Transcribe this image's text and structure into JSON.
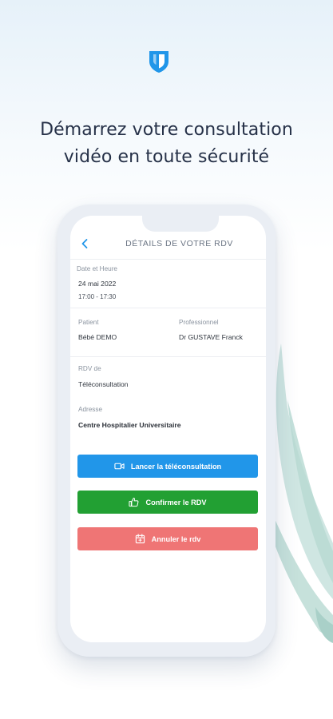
{
  "headline": {
    "line1": "Démarrez votre consultation",
    "line2": "vidéo en toute sécurité"
  },
  "screen": {
    "title": "DÉTAILS DE VOTRE RDV",
    "date_label": "Date et Heure",
    "date_value": "24 mai 2022",
    "time_value": "17:00 - 17:30",
    "patient_label": "Patient",
    "patient_value": "Bébé DEMO",
    "professional_label": "Professionnel",
    "professional_value": "Dr GUSTAVE Franck",
    "rdv_label": "RDV de",
    "rdv_value": "Téléconsultation",
    "address_label": "Adresse",
    "address_value": "Centre Hospitalier Universitaire",
    "buttons": {
      "teleconsult": "Lancer la téléconsultation",
      "confirm": "Confirmer le RDV",
      "cancel": "Annuler le rdv"
    }
  },
  "colors": {
    "brand_blue": "#2196e9",
    "confirm_green": "#22a033",
    "cancel_red": "#ef7575",
    "headline_text": "#263148"
  },
  "icons": [
    "shield-icon",
    "back-chevron-icon",
    "video-camera-icon",
    "thumbs-up-icon",
    "calendar-icon"
  ]
}
